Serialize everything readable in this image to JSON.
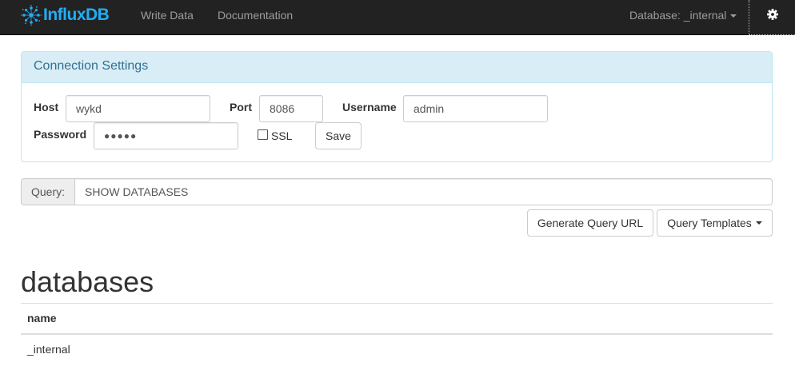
{
  "navbar": {
    "brand": "InfluxDB",
    "links": [
      "Write Data",
      "Documentation"
    ],
    "database_selector": "Database: _internal",
    "settings_icon": "gear-icon"
  },
  "connection": {
    "title": "Connection Settings",
    "host_label": "Host",
    "host_value": "wykd",
    "port_label": "Port",
    "port_value": "8086",
    "username_label": "Username",
    "username_value": "admin",
    "password_label": "Password",
    "password_value": "●●●●●",
    "ssl_label": "SSL",
    "ssl_checked": false,
    "save_label": "Save"
  },
  "query": {
    "addon_label": "Query:",
    "value": "SHOW DATABASES",
    "generate_url_label": "Generate Query URL",
    "templates_label": "Query Templates"
  },
  "results": {
    "title": "databases",
    "columns": [
      "name"
    ],
    "rows": [
      [
        "_internal"
      ]
    ]
  },
  "colors": {
    "navbar_bg": "#222222",
    "brand": "#22adf6",
    "panel_heading_bg": "#d9edf7",
    "panel_heading_text": "#31708f"
  }
}
